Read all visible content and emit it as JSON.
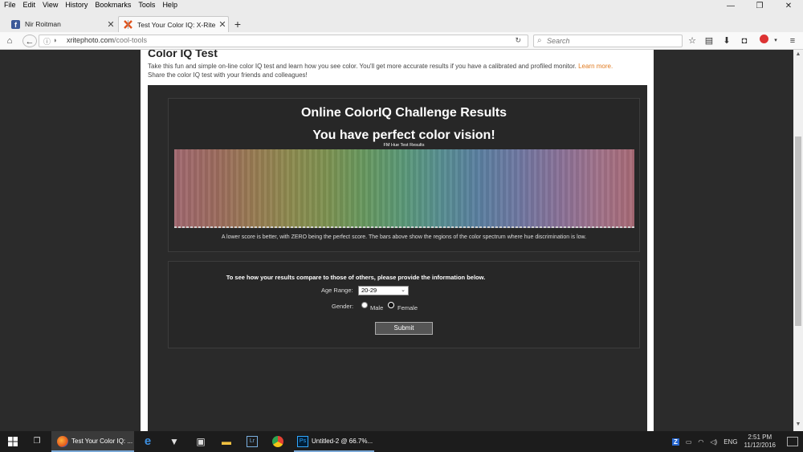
{
  "menubar": {
    "items": [
      "File",
      "Edit",
      "View",
      "History",
      "Bookmarks",
      "Tools",
      "Help"
    ]
  },
  "window_controls": {
    "minimize": "—",
    "restore": "❐",
    "close": "✕"
  },
  "tabs": [
    {
      "label": "Nir Roitman",
      "icon": "facebook-icon",
      "icon_color": "#3b5998"
    },
    {
      "label": "Test Your Color IQ: X-Rite ...",
      "icon": "xrite-icon",
      "active": true
    }
  ],
  "newtab_label": "+",
  "navbar": {
    "url_host": "xritephoto.com",
    "url_path": "/cool-tools",
    "search_placeholder": "Search"
  },
  "page": {
    "title": "Color IQ Test",
    "intro_text": "Take this fun and simple on-line color IQ test and learn how you see color. You'll get more accurate results if you have a calibrated and profiled monitor.",
    "learn_more": "Learn more.",
    "share_text": "Share the color IQ test with your friends and colleagues!",
    "accent_color": "#e07a1f"
  },
  "results": {
    "title": "Online ColorIQ Challenge Results",
    "verdict": "You have perfect color vision!",
    "chart_label": "FM Hue Test Results",
    "note": "A lower score is better, with ZERO being the perfect score. The bars above show the regions of the color spectrum where hue discrimination is low."
  },
  "compare": {
    "prompt": "To see how your results compare to those of others, please provide the information below.",
    "age_label": "Age Range:",
    "age_value": "20-29",
    "gender_label": "Gender:",
    "male_label": "Male",
    "female_label": "Female",
    "gender_selected": "Female",
    "submit_label": "Submit"
  },
  "taskbar": {
    "firefox_label": "Test Your Color IQ: ...",
    "lr_label": "Lr",
    "ps_badge": "Ps",
    "ps_label": "Untitled-2 @ 66.7%...",
    "tray_z": "Z",
    "lang": "ENG",
    "time": "2:51 PM",
    "date": "11/12/2016"
  }
}
